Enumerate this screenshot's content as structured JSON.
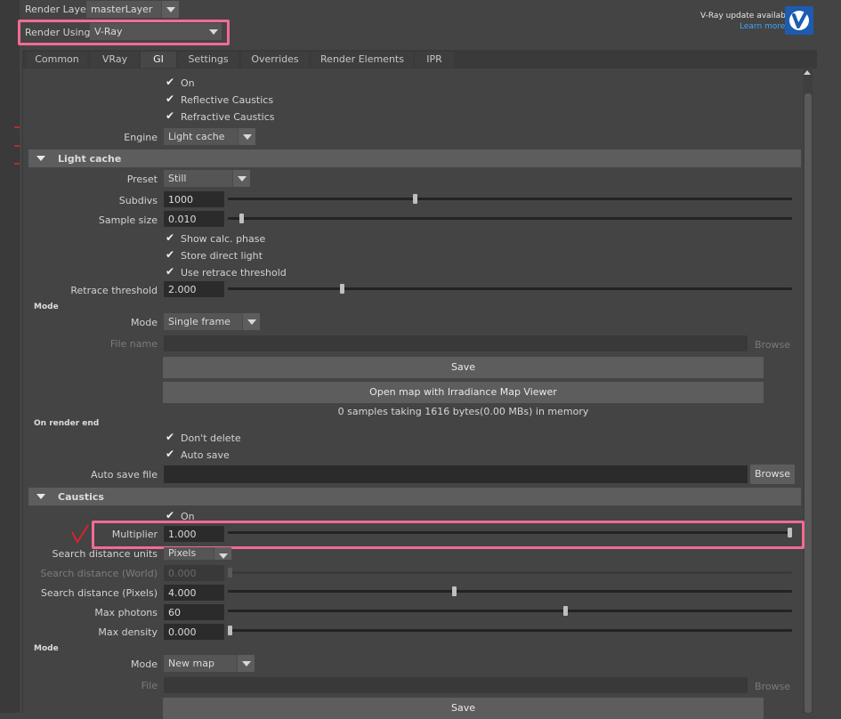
{
  "header": {
    "render_layer_label": "Render Layer",
    "render_layer_value": "masterLayer",
    "render_using_label": "Render Using",
    "render_using_value": "V-Ray",
    "update_title": "V-Ray update available",
    "update_link": "Learn more"
  },
  "tabs": [
    {
      "label": "Common"
    },
    {
      "label": "VRay"
    },
    {
      "label": "GI",
      "active": true
    },
    {
      "label": "Settings"
    },
    {
      "label": "Overrides"
    },
    {
      "label": "Render Elements"
    },
    {
      "label": "IPR"
    }
  ],
  "top_options": {
    "on": "On",
    "reflective": "Reflective Caustics",
    "refractive": "Refractive Caustics",
    "engine_label": "Engine",
    "engine_value": "Light cache"
  },
  "light_cache": {
    "title": "Light cache",
    "preset_label": "Preset",
    "preset_value": "Still",
    "subdivs_label": "Subdivs",
    "subdivs_value": "1000",
    "subdivs_level": 0.33,
    "sample_size_label": "Sample size",
    "sample_size_value": "0.010",
    "sample_size_level": 0.02,
    "show_calc": "Show calc. phase",
    "store_direct": "Store direct light",
    "use_retrace": "Use retrace threshold",
    "retrace_label": "Retrace threshold",
    "retrace_value": "2.000",
    "retrace_level": 0.2,
    "mode_header": "Mode",
    "mode_label": "Mode",
    "mode_value": "Single frame",
    "file_name_label": "File name",
    "browse": "Browse",
    "save_button": "Save",
    "open_map_button": "Open map with Irradiance Map Viewer",
    "memory_status": "0 samples taking 1616 bytes(0.00 MBs) in memory",
    "on_render_end_header": "On render end",
    "dont_delete": "Don't delete",
    "auto_save": "Auto save",
    "auto_save_file_label": "Auto save file",
    "browse_active": "Browse"
  },
  "caustics": {
    "title": "Caustics",
    "on": "On",
    "multiplier_label": "Multiplier",
    "multiplier_value": "1.000",
    "multiplier_level": 1.0,
    "search_units_label": "Search distance units",
    "search_units_value": "Pixels",
    "search_world_label": "Search distance (World)",
    "search_world_value": "0.000",
    "search_world_level": 0.0,
    "search_pixels_label": "Search distance (Pixels)",
    "search_pixels_value": "4.000",
    "search_pixels_level": 0.4,
    "max_photons_label": "Max photons",
    "max_photons_value": "60",
    "max_photons_level": 0.6,
    "max_density_label": "Max density",
    "max_density_value": "0.000",
    "max_density_level": 0.0,
    "mode_header": "Mode",
    "mode_label": "Mode",
    "mode_value": "New map",
    "file_label": "File",
    "browse": "Browse",
    "save_button": "Save"
  },
  "colors": {
    "highlight": "#f26b93",
    "annotation": "#e0202a",
    "link": "#3ea6ff",
    "vray_logo": "#1d5bb0"
  }
}
